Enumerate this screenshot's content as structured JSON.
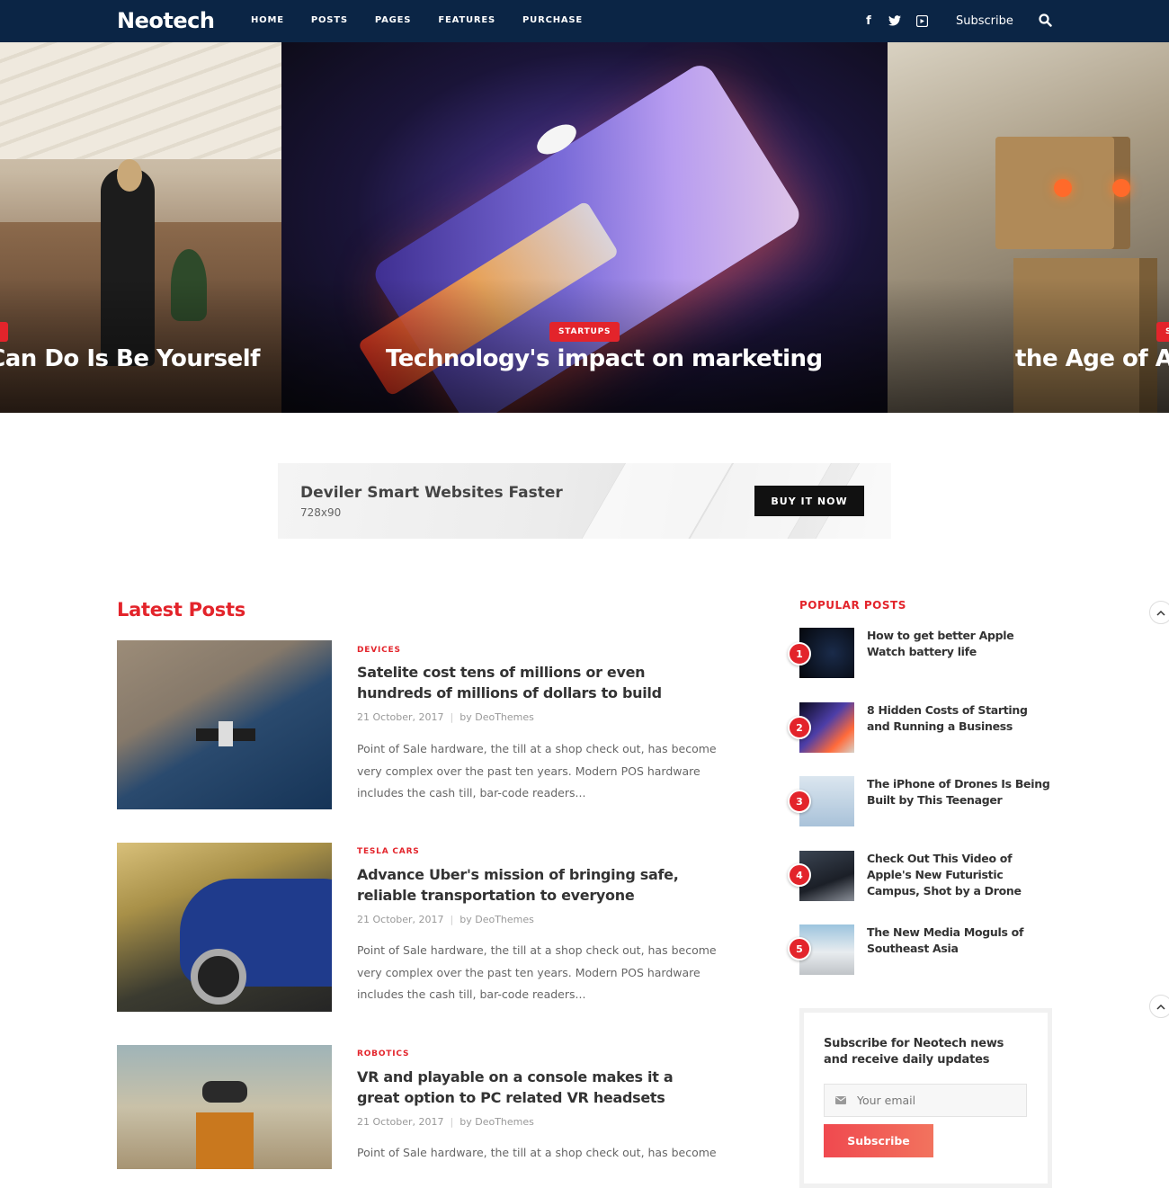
{
  "brand": {
    "logo": "Neotech",
    "accent": "#e3242b",
    "nav_bg": "#0b2545"
  },
  "nav": {
    "items": [
      "HOME",
      "POSTS",
      "PAGES",
      "FEATURES",
      "PURCHASE"
    ],
    "social": [
      "facebook-icon",
      "twitter-icon",
      "youtube-icon"
    ],
    "subscribe_label": "Subscribe",
    "search_icon": "search-icon"
  },
  "hero": {
    "left": {
      "title": "u Can Do Is Be Yourself",
      "tag": "S"
    },
    "center": {
      "title": "Technology's impact on marketing",
      "tag": "STARTUPS"
    },
    "right": {
      "title": "the Age of Art",
      "tag": "S"
    }
  },
  "ad": {
    "title": "Deviler Smart Websites Faster",
    "size": "728x90",
    "button": "BUY IT NOW"
  },
  "latest": {
    "heading": "Latest Posts",
    "posts": [
      {
        "category": "DEVICES",
        "title": "Satelite cost tens of millions or even hundreds of millions of dollars to build",
        "date": "21 October, 2017",
        "author": "by DeoThemes",
        "excerpt": "Point of Sale hardware, the till at a shop check out, has become very complex over the past ten years. Modern POS hardware includes the cash till, bar-code readers..."
      },
      {
        "category": "TESLA CARS",
        "title": "Advance Uber's mission of bringing safe, reliable transportation to everyone",
        "date": "21 October, 2017",
        "author": "by DeoThemes",
        "excerpt": "Point of Sale hardware, the till at a shop check out, has become very complex over the past ten years. Modern POS hardware includes the cash till, bar-code readers..."
      },
      {
        "category": "ROBOTICS",
        "title": "VR and playable on a console makes it a great option to PC related VR headsets",
        "date": "21 October, 2017",
        "author": "by DeoThemes",
        "excerpt": "Point of Sale hardware, the till at a shop check out, has become"
      }
    ]
  },
  "popular": {
    "heading": "POPULAR POSTS",
    "items": [
      {
        "num": "1",
        "title": "How to get better Apple Watch battery life"
      },
      {
        "num": "2",
        "title": "8 Hidden Costs of Starting and Running a Business"
      },
      {
        "num": "3",
        "title": "The iPhone of Drones Is Being Built by This Teenager"
      },
      {
        "num": "4",
        "title": "Check Out This Video of Apple's New Futuristic Campus, Shot by a Drone"
      },
      {
        "num": "5",
        "title": "The New Media Moguls of Southeast Asia"
      }
    ]
  },
  "subscribe": {
    "title": "Subscribe for Neotech news and receive daily updates",
    "placeholder": "Your email",
    "button": "Subscribe"
  }
}
